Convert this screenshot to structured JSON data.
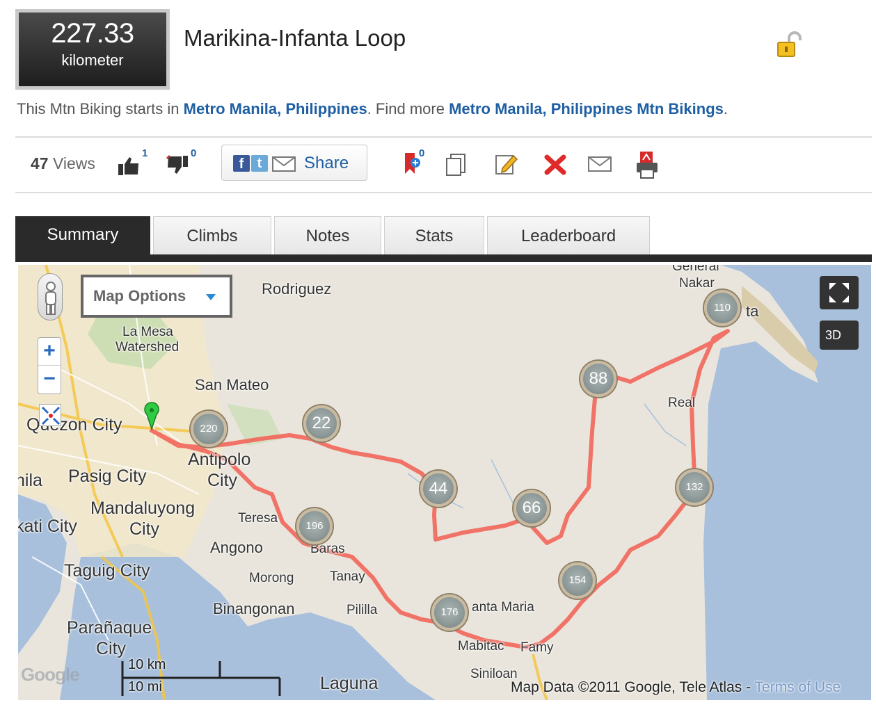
{
  "route": {
    "distance_value": "227.33",
    "distance_unit": "kilometer",
    "title": "Marikina-Infanta Loop",
    "start_prefix": "This Mtn Biking starts in ",
    "start_location": "Metro Manila, Philippines",
    "find_more_prefix": ". Find more ",
    "find_more_link": "Metro Manila, Philippines Mtn Bikings",
    "find_more_suffix": "."
  },
  "toolbar": {
    "views_count": "47",
    "views_label": " Views",
    "likes": "1",
    "dislikes": "0",
    "share_label": "Share",
    "bookmarks": "0",
    "icons": [
      "bookmark-add-icon",
      "copy-icon",
      "edit-icon",
      "delete-icon",
      "email-icon",
      "pdf-print-icon"
    ]
  },
  "tabs": [
    {
      "label": "Summary",
      "active": true
    },
    {
      "label": "Climbs",
      "active": false
    },
    {
      "label": "Notes",
      "active": false
    },
    {
      "label": "Stats",
      "active": false
    },
    {
      "label": "Leaderboard",
      "active": false
    }
  ],
  "map": {
    "options_label": "Map Options",
    "btn_3d": "3D",
    "zoom_in": "+",
    "zoom_out": "−",
    "scale_km": "10 km",
    "scale_mi": "10 mi",
    "google_logo": "Google",
    "credit": "Map Data ©2011 Google, Tele Atlas - ",
    "terms_link": "Terms of Use",
    "labels": {
      "general_nakar_1": "General",
      "general_nakar_2": "Nakar",
      "rodriguez": "Rodriguez",
      "la_mesa_1": "La Mesa",
      "la_mesa_2": "Watershed",
      "san_mateo": "San Mateo",
      "real": "Real",
      "quezon_city": "Quezon City",
      "antipolo_1": "Antipolo",
      "antipolo_2": "City",
      "pasig_city": "Pasig City",
      "mandaluyong_1": "Mandaluyong",
      "mandaluyong_2": "City",
      "teresa": "Teresa",
      "makati": "kati City",
      "angono": "Angono",
      "baras": "Baras",
      "taguig_city": "Taguig City",
      "morong": "Morong",
      "tanay": "Tanay",
      "binangonan": "Binangonan",
      "pililla": "Pililla",
      "santa_maria": "anta Maria",
      "paranaque_1": "Parañaque",
      "paranaque_2": "City",
      "mabitac": "Mabitac",
      "famy": "Famy",
      "siniloan": "Siniloan",
      "laguna": "Laguna",
      "manila_edge": "nila",
      "ta_edge": "ta"
    },
    "markers": [
      "110",
      "88",
      "22",
      "220",
      "44",
      "66",
      "132",
      "196",
      "154",
      "176"
    ]
  }
}
